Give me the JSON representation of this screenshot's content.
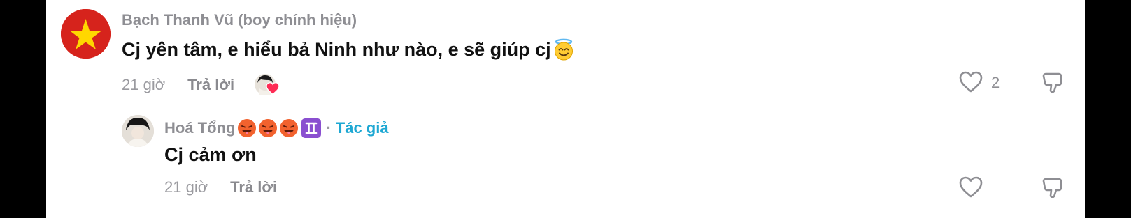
{
  "comments": [
    {
      "username": "Bạch Thanh Vũ (boy chính hiệu)",
      "text": "Cj yên tâm, e hiểu bả Ninh như nào, e sẽ giúp cj",
      "emoji": "smiling-face-with-halo-icon",
      "time": "21 giờ",
      "reply_label": "Trả lời",
      "like_count": "2",
      "creator_liked": true
    },
    {
      "username": "Hoá Tổng",
      "author_tag": "Tác giả",
      "separator": "·",
      "text": "Cj cảm ơn",
      "time": "21 giờ",
      "reply_label": "Trả lời"
    }
  ],
  "colors": {
    "author_tag": "#1ea8d3",
    "username": "#8e8e93",
    "text": "#111111",
    "flag_red": "#d6231c",
    "flag_star": "#ffd700"
  }
}
